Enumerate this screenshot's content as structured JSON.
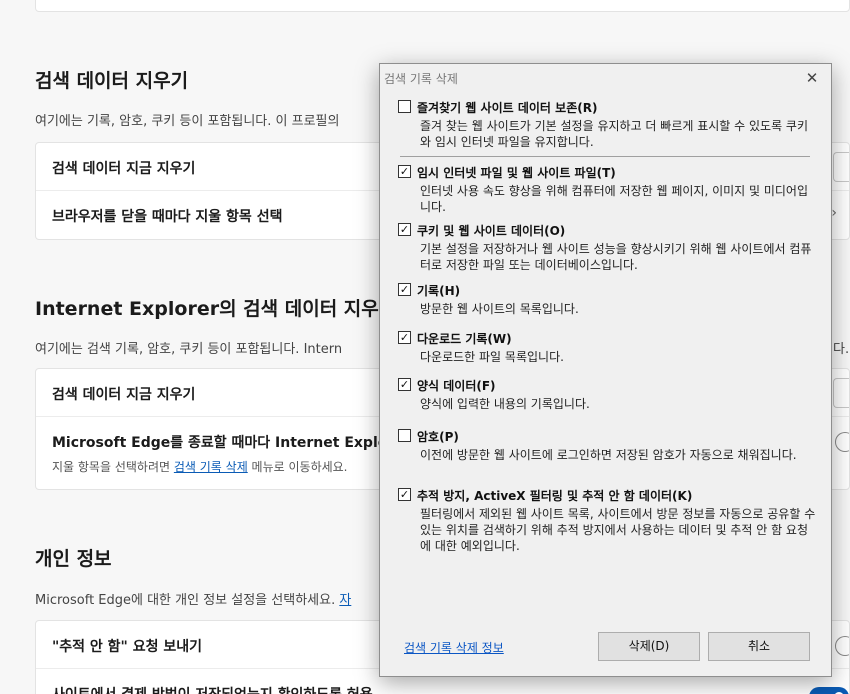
{
  "settings": {
    "section1": {
      "title": "검색 데이터 지우기",
      "desc": "여기에는 기록, 암호, 쿠키 등이 포함됩니다. 이 프로필의",
      "rows": [
        "검색 데이터 지금 지우기",
        "브라우저를 닫을 때마다 지울 항목 선택"
      ]
    },
    "section2": {
      "title": "Internet Explorer의 검색 데이터 지우",
      "desc": "여기에는 검색 기록, 암호, 쿠키 등이 포함됩니다. Intern",
      "desc_tail": "다.",
      "row1": "검색 데이터 지금 지우기",
      "row2_title": "Microsoft Edge를 종료할 때마다 Internet Explorer",
      "row2_sub_before": "지울 항목을 선택하려면 ",
      "row2_sub_link": "검색 기록 삭제",
      "row2_sub_after": " 메뉴로 이동하세요."
    },
    "section3": {
      "title": "개인 정보",
      "desc": "Microsoft Edge에 대한 개인 정보 설정을 선택하세요.",
      "desc_link_partial": "자",
      "row1": "\"추적 안 함\" 요청 보내기",
      "row2": "사이트에서 결제 방법이 저장되었는지 확인하도록 허용"
    }
  },
  "dialog": {
    "title": "검색 기록 삭제",
    "close_glyph": "✕",
    "options": [
      {
        "label": "즐겨찾기 웹 사이트 데이터 보존(R)",
        "checked": false,
        "desc": "즐겨 찾는 웹 사이트가 기본 설정을 유지하고 더 빠르게 표시할 수 있도록 쿠키와 임시 인터넷 파일을 유지합니다."
      },
      {
        "label": "임시 인터넷 파일 및 웹 사이트 파일(T)",
        "checked": true,
        "desc": "인터넷 사용 속도 향상을 위해 컴퓨터에 저장한 웹 페이지, 이미지 및 미디어입니다."
      },
      {
        "label": "쿠키 및 웹 사이트 데이터(O)",
        "checked": true,
        "desc": "기본 설정을 저장하거나 웹 사이트 성능을 향상시키기 위해 웹 사이트에서 컴퓨터로 저장한 파일 또는 데이터베이스입니다."
      },
      {
        "label": "기록(H)",
        "checked": true,
        "desc": "방문한 웹 사이트의 목록입니다."
      },
      {
        "label": "다운로드 기록(W)",
        "checked": true,
        "desc": "다운로드한 파일 목록입니다."
      },
      {
        "label": "양식 데이터(F)",
        "checked": true,
        "desc": "양식에 입력한 내용의 기록입니다."
      },
      {
        "label": "암호(P)",
        "checked": false,
        "desc": "이전에 방문한 웹 사이트에 로그인하면 저장된 암호가 자동으로 채워집니다."
      },
      {
        "label": "추적 방지, ActiveX 필터링 및 추적 안 함 데이터(K)",
        "checked": true,
        "desc": "필터링에서 제외된 웹 사이트 목록, 사이트에서 방문 정보를 자동으로 공유할 수 있는 위치를 검색하기 위해 추적 방지에서 사용하는 데이터 및 추적 안 함 요청에 대한 예외입니다."
      }
    ],
    "link": "검색 기록 삭제 정보",
    "delete_button": "삭제(D)",
    "cancel_button": "취소",
    "check_glyph": "✓"
  },
  "colors": {
    "accent": "#0a5bb5",
    "dialog_bg": "#f0f0f0",
    "page_bg": "#f7f7f7"
  },
  "icons": {
    "chevron": "chevron-right-icon",
    "close": "close-icon",
    "check": "check-icon"
  }
}
